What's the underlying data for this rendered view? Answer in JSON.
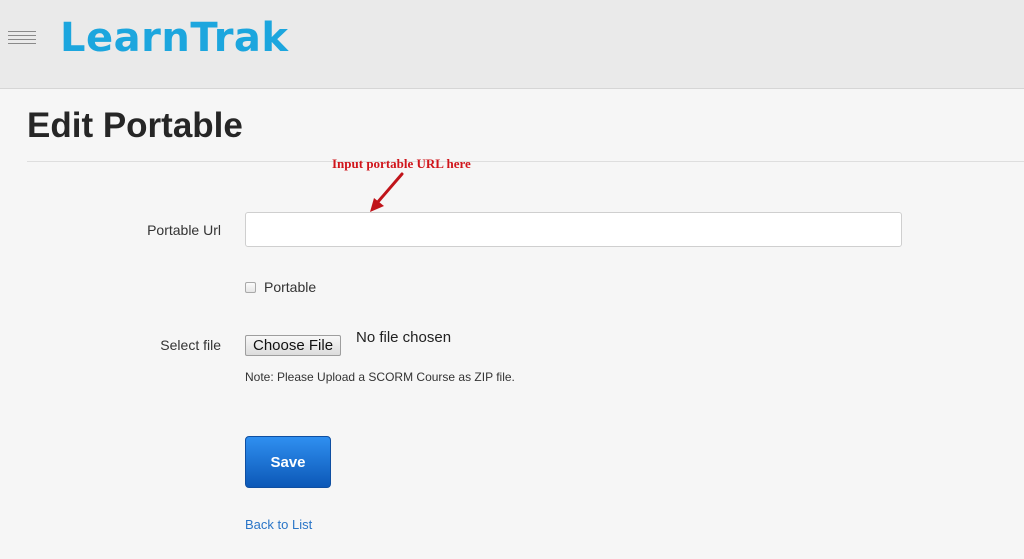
{
  "header": {
    "menu_icon": "hamburger-menu-icon",
    "brand": "LearnTrak",
    "brand_color": "#1ca6de"
  },
  "page": {
    "title": "Edit Portable"
  },
  "annotation": {
    "text": "Input portable URL here",
    "color": "#d0151b",
    "icon": "arrow-icon"
  },
  "form": {
    "url_label": "Portable Url",
    "url_value": "",
    "portable_checkbox_label": "Portable",
    "portable_checked": false,
    "file_label": "Select file",
    "choose_file_button": "Choose File",
    "file_status": "No file chosen",
    "note": "Note: Please Upload a SCORM Course as ZIP file.",
    "save_button": "Save",
    "save_color": "#1470d0",
    "back_link": "Back to List"
  }
}
